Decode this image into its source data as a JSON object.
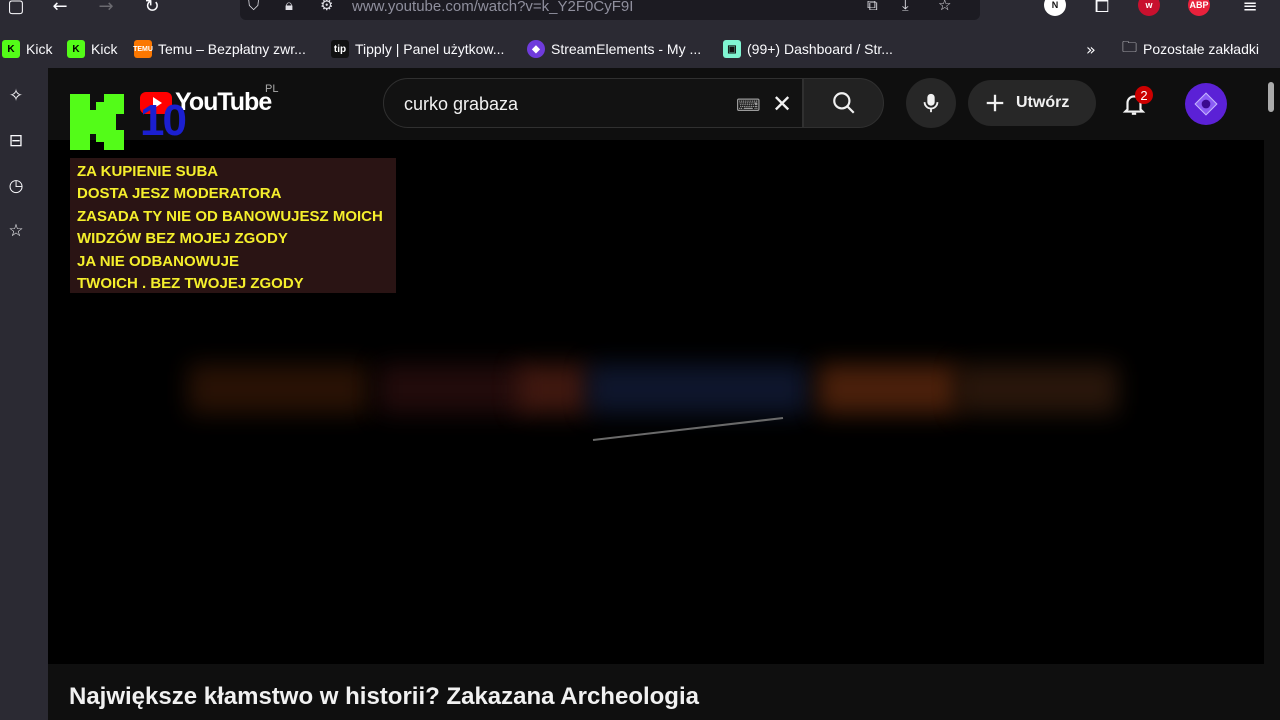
{
  "browser": {
    "url": "www.youtube.com/watch?v=k_Y2F0CyF9I",
    "extensions": [
      "N",
      "ABP"
    ],
    "bookmarks": [
      {
        "label": "Kick",
        "icon": "kick-icon",
        "color": "#53fc18"
      },
      {
        "label": "Kick",
        "icon": "kick-icon",
        "color": "#53fc18"
      },
      {
        "label": "Temu – Bezpłatny zwr...",
        "icon": "temu-icon",
        "color": "#fb7701"
      },
      {
        "label": "Tipply | Panel użytkow...",
        "icon": "tipply-icon",
        "color": "#111111"
      },
      {
        "label": "StreamElements - My ...",
        "icon": "streamelements-icon",
        "color": "#6f3bdc"
      },
      {
        "label": "(99+) Dashboard / Str...",
        "icon": "streamlabs-icon",
        "color": "#80f5d2"
      }
    ],
    "other_bookmarks": "Pozostałe zakładki"
  },
  "youtube": {
    "logo_text": "YouTube",
    "country_code": "PL",
    "search_value": "curko grabaza",
    "create_label": "Utwórz",
    "notification_count": "2"
  },
  "overlay": {
    "kick_number": "10",
    "note_lines": [
      "ZA KUPIENIE SUBA",
      "DOSTA JESZ MODERATORA",
      "ZASADA  TY NIE OD BANOWUJESZ MOICH",
      "WIDZÓW BEZ MOJEJ ZGODY",
      "JA NIE ODBANOWUJE",
      "TWOICH . BEZ TWOJEJ ZGODY"
    ]
  },
  "video": {
    "title": "Największe kłamstwo w historii? Zakazana Archeologia"
  },
  "colors": {
    "accent": "#ff0000",
    "note_text": "#f5ef2c",
    "kick_green": "#53fc18",
    "avatar": "#5b21d6"
  }
}
